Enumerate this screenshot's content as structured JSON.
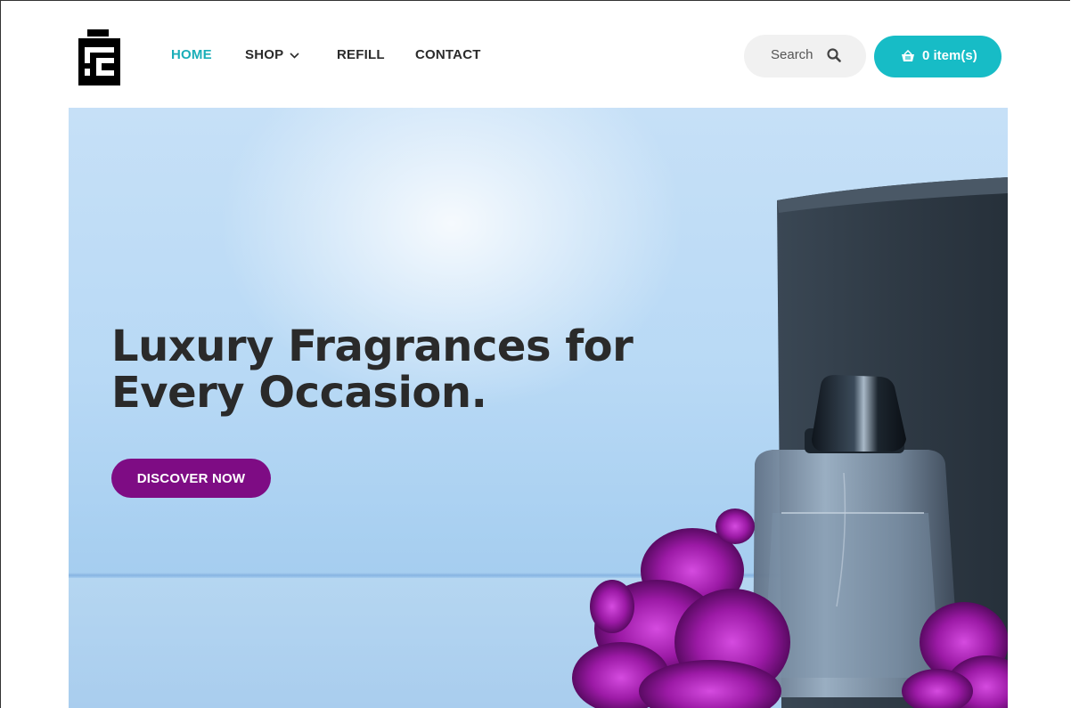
{
  "header": {
    "nav": [
      {
        "label": "HOME",
        "active": true
      },
      {
        "label": "SHOP",
        "has_dropdown": true
      },
      {
        "label": "REFILL"
      },
      {
        "label": "CONTACT"
      }
    ],
    "search": {
      "label": "Search",
      "icon": "search-icon"
    },
    "cart": {
      "label": "0 item(s)",
      "icon": "basket-icon"
    }
  },
  "hero": {
    "headline_line1": "Luxury Fragrances for",
    "headline_line2": "Every Occasion.",
    "cta_label": "DISCOVER NOW"
  },
  "colors": {
    "accent": "#17bcc6",
    "nav_active": "#1aaeb8",
    "cta": "#7e0c84",
    "text": "#2b2b2b"
  }
}
